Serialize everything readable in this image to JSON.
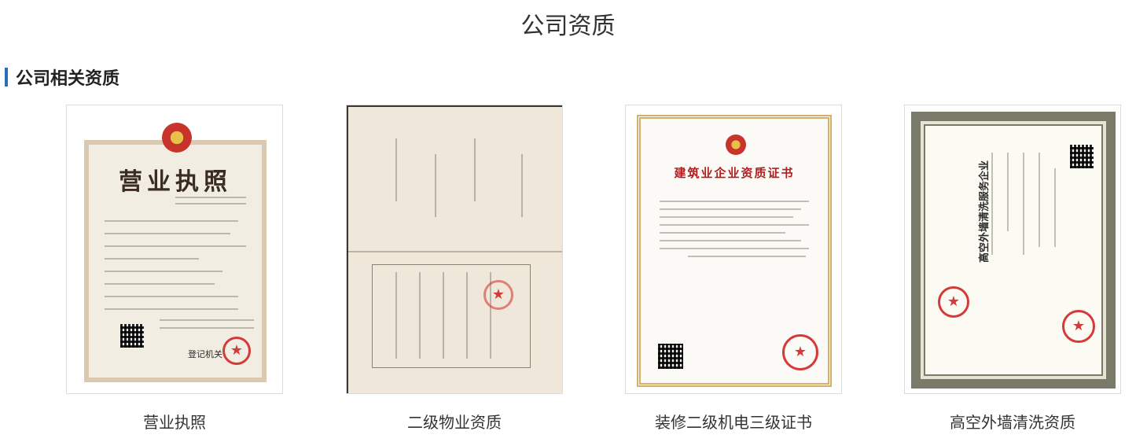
{
  "page": {
    "title": "公司资质"
  },
  "section": {
    "title": "公司相关资质"
  },
  "certificates": [
    {
      "caption": "营业执照",
      "doc_heading": "营业执照",
      "doc_footer": "登记机关"
    },
    {
      "caption": "二级物业资质"
    },
    {
      "caption": "装修二级机电三级证书",
      "doc_heading": "建筑业企业资质证书"
    },
    {
      "caption": "高空外墙清洗资质",
      "doc_heading": "高空外墙清洗服务企业"
    }
  ],
  "colors": {
    "accent_bar": "#2a6fb5",
    "seal_red": "#d43a3a"
  }
}
